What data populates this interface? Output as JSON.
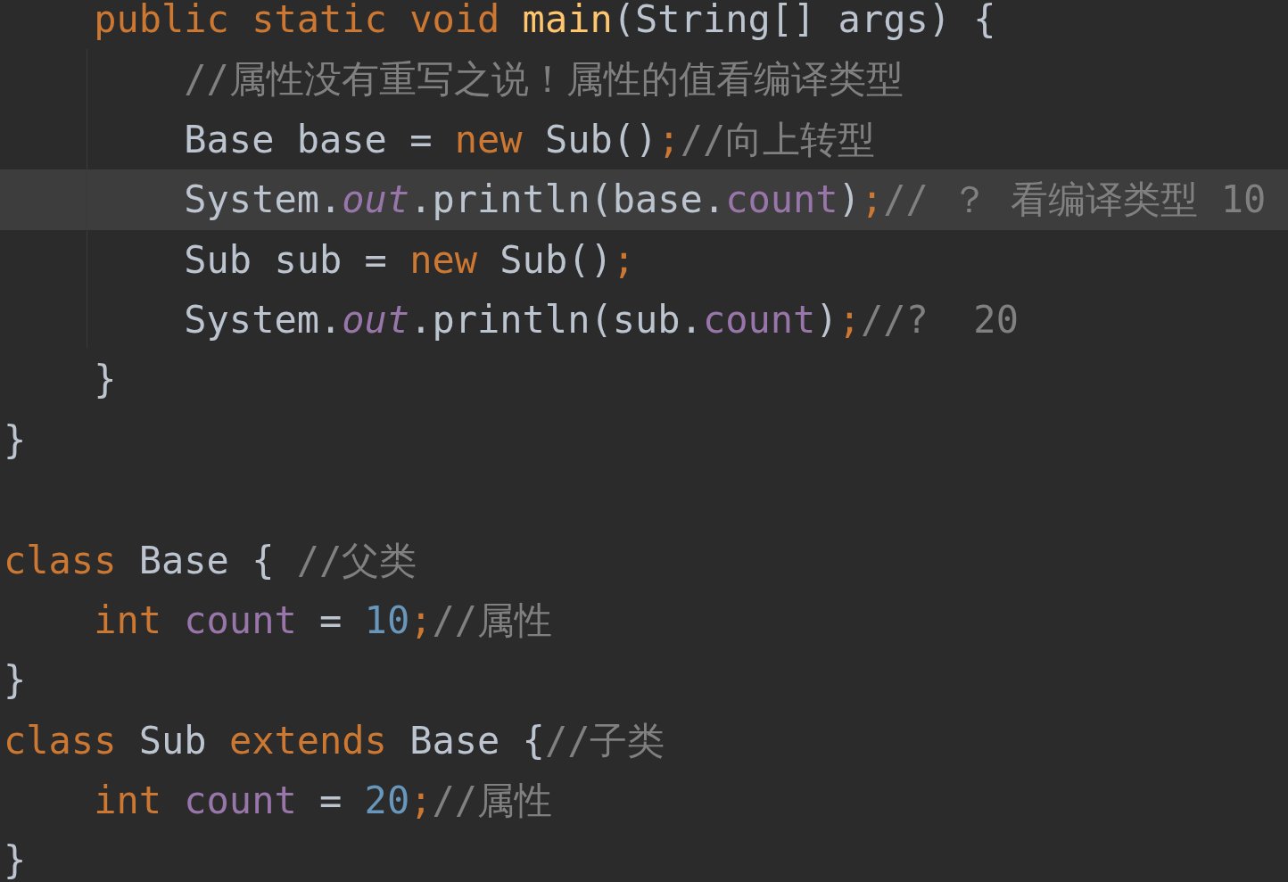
{
  "editor": {
    "lines": [
      {
        "kind": "code",
        "current": false,
        "tokens": [
          {
            "text": "    public static void ",
            "kind": "keyword"
          },
          {
            "text": "main",
            "kind": "method"
          },
          {
            "text": "(String[] args) {",
            "kind": "plain"
          }
        ]
      },
      {
        "kind": "code",
        "current": false,
        "tokens": [
          {
            "text": "        //属性没有重写之说！属性的值看编译类型",
            "kind": "comment"
          }
        ]
      },
      {
        "kind": "code",
        "current": false,
        "tokens": [
          {
            "text": "        Base base = ",
            "kind": "plain"
          },
          {
            "text": "new ",
            "kind": "keyword"
          },
          {
            "text": "Sub()",
            "kind": "plain"
          },
          {
            "text": ";",
            "kind": "keyword"
          },
          {
            "text": "//向上转型",
            "kind": "comment"
          }
        ]
      },
      {
        "kind": "code",
        "current": true,
        "tokens": [
          {
            "text": "        System.",
            "kind": "plain"
          },
          {
            "text": "out",
            "kind": "static"
          },
          {
            "text": ".println(base.",
            "kind": "plain"
          },
          {
            "text": "count",
            "kind": "field"
          },
          {
            "text": ")",
            "kind": "plain"
          },
          {
            "text": ";",
            "kind": "keyword"
          },
          {
            "text": "// ？ 看编译类型 10",
            "kind": "comment"
          }
        ]
      },
      {
        "kind": "code",
        "current": false,
        "tokens": [
          {
            "text": "        Sub sub = ",
            "kind": "plain"
          },
          {
            "text": "new ",
            "kind": "keyword"
          },
          {
            "text": "Sub()",
            "kind": "plain"
          },
          {
            "text": ";",
            "kind": "keyword"
          }
        ]
      },
      {
        "kind": "code",
        "current": false,
        "tokens": [
          {
            "text": "        System.",
            "kind": "plain"
          },
          {
            "text": "out",
            "kind": "static"
          },
          {
            "text": ".println(sub.",
            "kind": "plain"
          },
          {
            "text": "count",
            "kind": "field"
          },
          {
            "text": ")",
            "kind": "plain"
          },
          {
            "text": ";",
            "kind": "keyword"
          },
          {
            "text": "//?  20",
            "kind": "comment"
          }
        ]
      },
      {
        "kind": "code",
        "current": false,
        "tokens": [
          {
            "text": "    }",
            "kind": "plain"
          }
        ]
      },
      {
        "kind": "code",
        "current": false,
        "tokens": [
          {
            "text": "}",
            "kind": "plain"
          }
        ]
      },
      {
        "kind": "blank"
      },
      {
        "kind": "code",
        "current": false,
        "tokens": [
          {
            "text": "class ",
            "kind": "keyword"
          },
          {
            "text": "Base { ",
            "kind": "plain"
          },
          {
            "text": "//父类",
            "kind": "comment"
          }
        ]
      },
      {
        "kind": "code",
        "current": false,
        "tokens": [
          {
            "text": "    int ",
            "kind": "keyword"
          },
          {
            "text": "count",
            "kind": "field"
          },
          {
            "text": " = ",
            "kind": "plain"
          },
          {
            "text": "10",
            "kind": "number"
          },
          {
            "text": ";",
            "kind": "keyword"
          },
          {
            "text": "//属性",
            "kind": "comment"
          }
        ]
      },
      {
        "kind": "code",
        "current": false,
        "tokens": [
          {
            "text": "}",
            "kind": "plain"
          }
        ]
      },
      {
        "kind": "code",
        "current": false,
        "tokens": [
          {
            "text": "class ",
            "kind": "keyword"
          },
          {
            "text": "Sub ",
            "kind": "plain"
          },
          {
            "text": "extends ",
            "kind": "keyword"
          },
          {
            "text": "Base {",
            "kind": "plain"
          },
          {
            "text": "//子类",
            "kind": "comment"
          }
        ]
      },
      {
        "kind": "code",
        "current": false,
        "tokens": [
          {
            "text": "    int ",
            "kind": "keyword"
          },
          {
            "text": "count",
            "kind": "field"
          },
          {
            "text": " = ",
            "kind": "plain"
          },
          {
            "text": "20",
            "kind": "number"
          },
          {
            "text": ";",
            "kind": "keyword"
          },
          {
            "text": "//属性",
            "kind": "comment"
          }
        ]
      },
      {
        "kind": "code",
        "current": false,
        "tokens": [
          {
            "text": "}",
            "kind": "plain"
          }
        ]
      }
    ]
  }
}
